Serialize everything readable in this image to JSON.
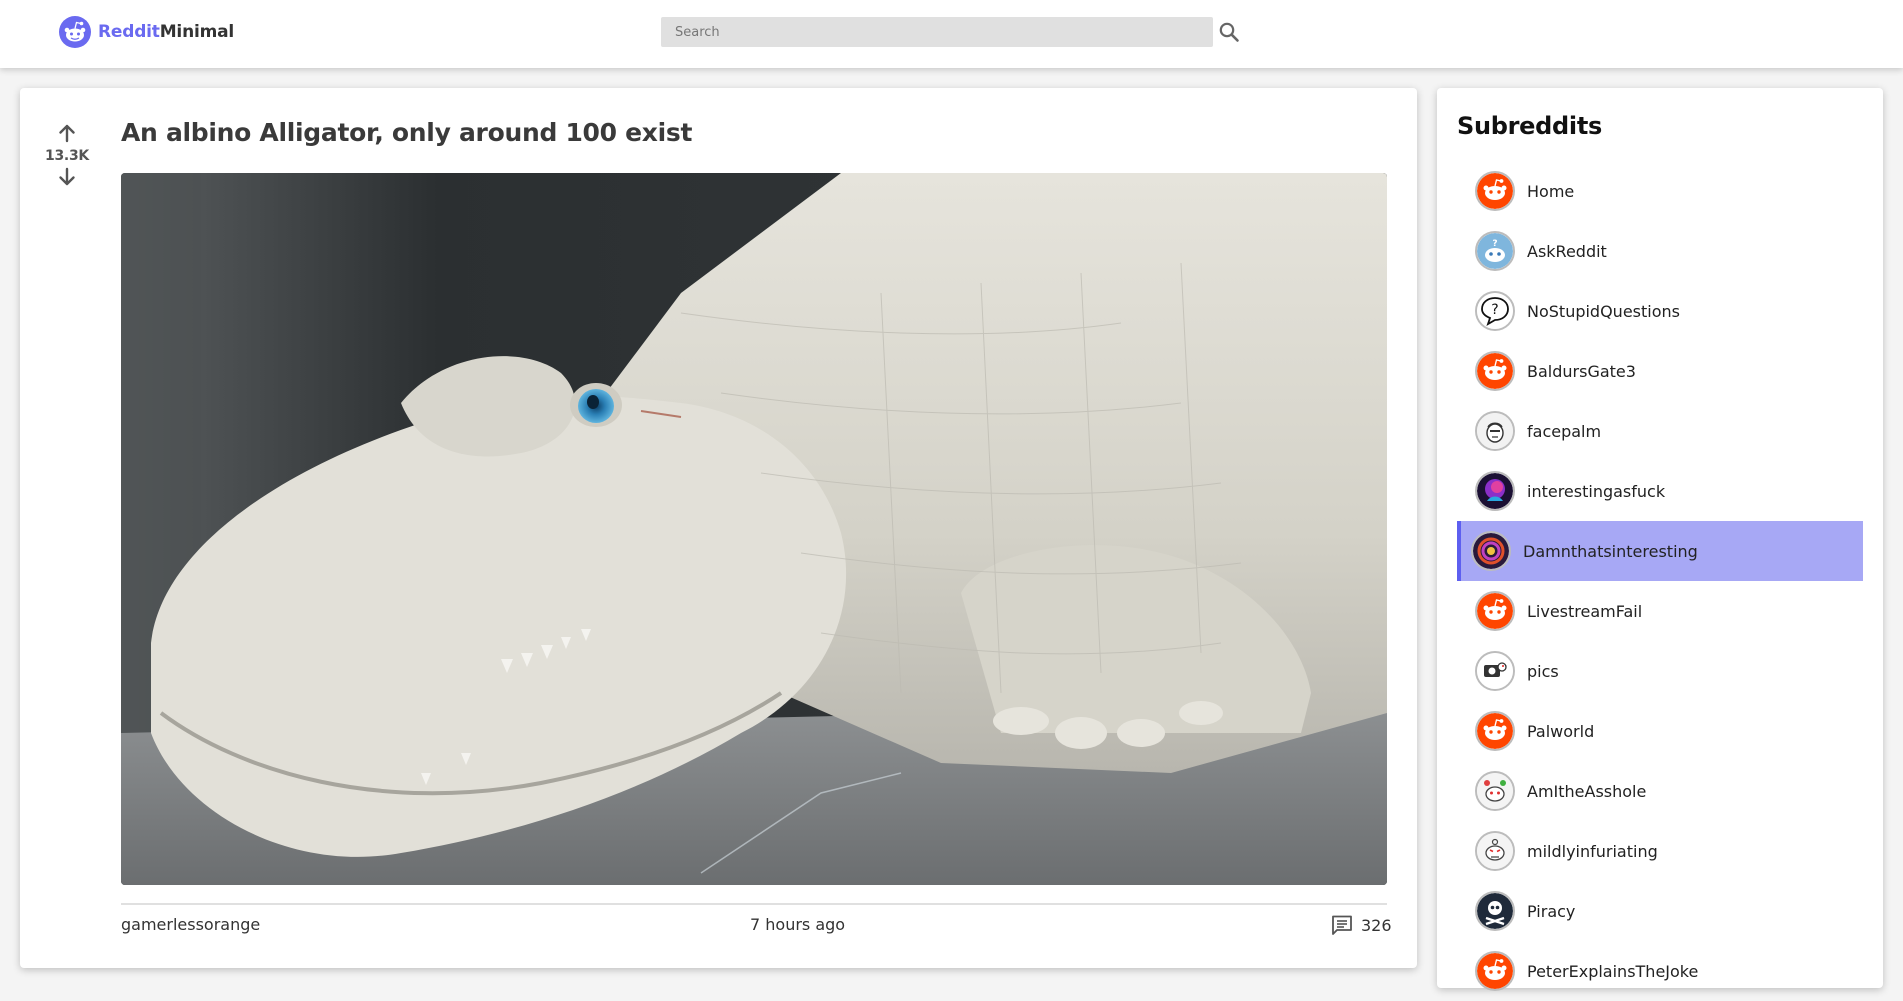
{
  "brand": {
    "name_part1": "Reddit",
    "name_part2": "Minimal",
    "accent": "#6a6af0"
  },
  "search": {
    "placeholder": "Search",
    "value": ""
  },
  "post": {
    "title": "An albino Alligator, only around 100 exist",
    "score": "13.3K",
    "author": "gamerlessorange",
    "time": "7 hours ago",
    "comments": "326",
    "image_subject": "albino-alligator"
  },
  "sidebar": {
    "title": "Subreddits",
    "active_color": "#a7a8f5",
    "items": [
      {
        "label": "Home",
        "icon": "reddit-snoo-icon"
      },
      {
        "label": "AskReddit",
        "icon": "askreddit-icon"
      },
      {
        "label": "NoStupidQuestions",
        "icon": "question-bubble-icon"
      },
      {
        "label": "BaldursGate3",
        "icon": "reddit-snoo-icon"
      },
      {
        "label": "facepalm",
        "icon": "facepalm-icon"
      },
      {
        "label": "interestingasfuck",
        "icon": "interestingasfuck-icon"
      },
      {
        "label": "Damnthatsinteresting",
        "icon": "damnthatsinteresting-icon",
        "active": true
      },
      {
        "label": "LivestreamFail",
        "icon": "reddit-snoo-icon"
      },
      {
        "label": "pics",
        "icon": "pics-icon"
      },
      {
        "label": "Palworld",
        "icon": "reddit-snoo-icon"
      },
      {
        "label": "AmItheAsshole",
        "icon": "amitheasshole-icon"
      },
      {
        "label": "mildlyinfuriating",
        "icon": "mildlyinfuriating-icon"
      },
      {
        "label": "Piracy",
        "icon": "piracy-icon"
      },
      {
        "label": "PeterExplainsTheJoke",
        "icon": "reddit-snoo-icon"
      }
    ]
  }
}
